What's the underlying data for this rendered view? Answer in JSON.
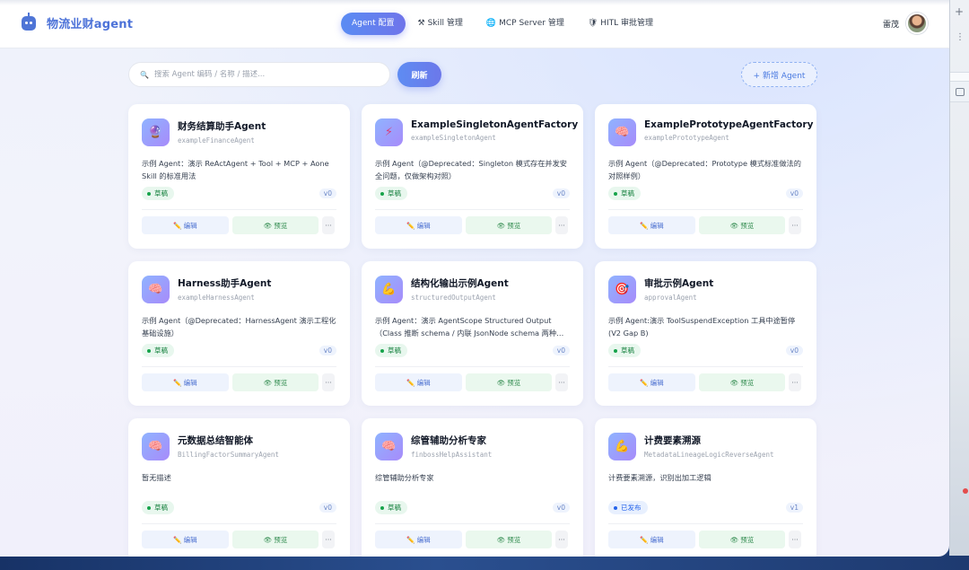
{
  "app": {
    "title": "物流业财agent",
    "logo_icon": "robot-icon"
  },
  "nav": [
    {
      "label": "Agent 配置",
      "icon": "",
      "active": true
    },
    {
      "label": "Skill 管理",
      "icon": "⚒"
    },
    {
      "label": "MCP Server 管理",
      "icon": "🌐"
    },
    {
      "label": "HITL 审批管理",
      "icon": "🛡"
    }
  ],
  "user": {
    "name": "雷茂",
    "avatar_icon": "user-avatar"
  },
  "toolbar": {
    "search_placeholder": "搜索 Agent 编码 / 名称 / 描述...",
    "search_icon": "🔍",
    "refresh_label": "刷新",
    "new_agent_label": "+ 新增 Agent"
  },
  "card_actions": {
    "edit_label": "编辑",
    "edit_icon": "✏️",
    "preview_label": "预览",
    "preview_icon": "👁",
    "more_label": "···"
  },
  "agents": [
    {
      "title": "财务结算助手Agent",
      "code": "exampleFinanceAgent",
      "icon": "🔮",
      "desc": "示例 Agent：演示 ReActAgent + Tool + MCP + Aone Skill 的标准用法",
      "status": "草稿",
      "version": "v0"
    },
    {
      "title": "ExampleSingletonAgentFactory",
      "code": "exampleSingletonAgent",
      "icon": "⚡",
      "desc": "示例 Agent（@Deprecated：Singleton 模式存在并发安全问题，仅做架构对照）",
      "status": "草稿",
      "version": "v0"
    },
    {
      "title": "ExamplePrototypeAgentFactory",
      "code": "examplePrototypeAgent",
      "icon": "🧠",
      "desc": "示例 Agent（@Deprecated：Prototype 模式标准做法的对照样例）",
      "status": "草稿",
      "version": "v0"
    },
    {
      "title": "Harness助手Agent",
      "code": "exampleHarnessAgent",
      "icon": "🧠",
      "desc": "示例 Agent（@Deprecated：HarnessAgent 演示工程化基础设施）",
      "status": "草稿",
      "version": "v0"
    },
    {
      "title": "结构化输出示例Agent",
      "code": "structuredOutputAgent",
      "icon": "💪",
      "desc": "示例 Agent：演示 AgentScope Structured Output（Class 推断 schema / 内联 JsonNode schema 两种用...",
      "status": "草稿",
      "version": "v0"
    },
    {
      "title": "审批示例Agent",
      "code": "approvalAgent",
      "icon": "🎯",
      "desc": "示例 Agent:演示 ToolSuspendException 工具中途暂停 (V2 Gap B)",
      "status": "草稿",
      "version": "v0"
    },
    {
      "title": "元数据总结智能体",
      "code": "BillingFactorSummaryAgent",
      "icon": "🧠",
      "desc": "暂无描述",
      "status": "草稿",
      "version": "v0"
    },
    {
      "title": "综管辅助分析专家",
      "code": "finbossHelpAssistant",
      "icon": "🧠",
      "desc": "综管辅助分析专家",
      "status": "草稿",
      "version": "v0"
    },
    {
      "title": "计费要素溯源",
      "code": "MetadataLineageLogicReverseAgent",
      "icon": "💪",
      "desc": "计费要素溯源，识别出加工逻辑",
      "status": "已发布",
      "version": "v1"
    }
  ],
  "colors": {
    "accent": "#5a8cf3",
    "brand": "#4c72d8",
    "draft": "#16a34a",
    "published": "#2563eb"
  }
}
